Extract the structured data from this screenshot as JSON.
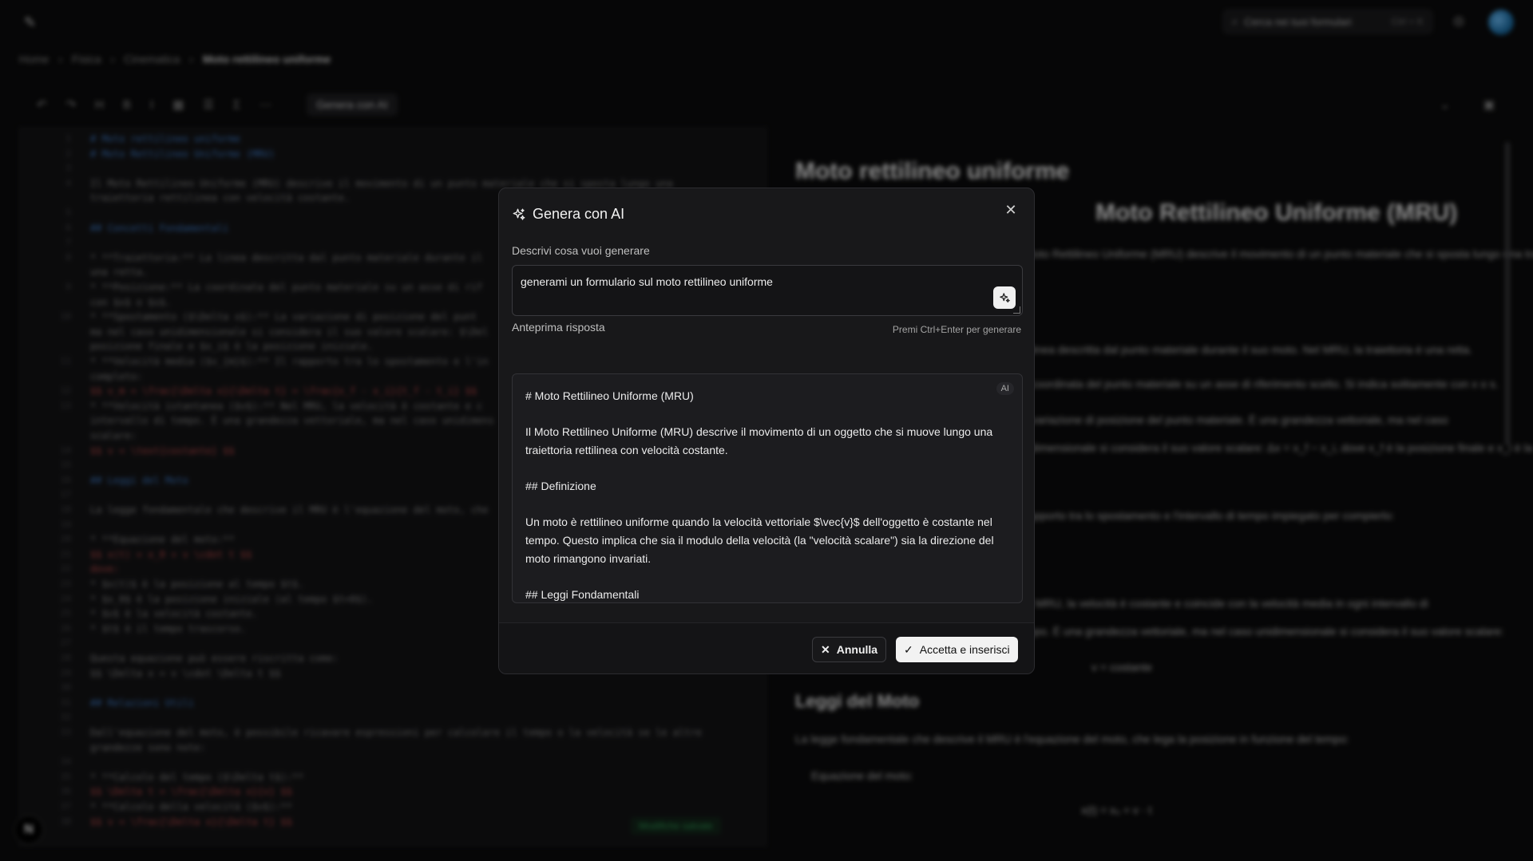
{
  "app": {
    "search_placeholder": "Cerca nei tuoi formulari",
    "search_shortcut": "Ctrl + K",
    "breadcrumb": [
      "Home",
      "Fisica",
      "Cinematica",
      "Moto rettilineo uniforme"
    ],
    "toolbar_ai_label": "Genera con AI",
    "saved_label": "Modifiche salvate",
    "editor_lines": [
      {
        "n": "1",
        "t": "# Moto rettilineo uniforme",
        "k": "h"
      },
      {
        "n": "2",
        "t": "# Moto Rettilineo Uniforme (MRU)",
        "k": "h"
      },
      {
        "n": "3",
        "t": "",
        "k": ""
      },
      {
        "n": "4",
        "t": "Il Moto Rettilineo Uniforme (MRU) descrive il movimento di un punto materiale che si sposta lungo una",
        "k": ""
      },
      {
        "n": "",
        "t": "traiettoria rettilinea con velocità costante.",
        "k": ""
      },
      {
        "n": "5",
        "t": "",
        "k": ""
      },
      {
        "n": "6",
        "t": "## Concetti Fondamentali",
        "k": "h"
      },
      {
        "n": "7",
        "t": "",
        "k": ""
      },
      {
        "n": "8",
        "t": "*   **Traiettoria:** La linea descritta dal punto materiale durante il",
        "k": ""
      },
      {
        "n": "",
        "t": "una retta.",
        "k": ""
      },
      {
        "n": "9",
        "t": "*   **Posizione:** La coordinata del punto materiale su un asse di rif",
        "k": ""
      },
      {
        "n": "",
        "t": "con $x$ o $s$.",
        "k": ""
      },
      {
        "n": "10",
        "t": "*   **Spostamento ($\\Delta x$):** La variazione di posizione del punt",
        "k": ""
      },
      {
        "n": "",
        "t": "ma nel caso unidimensionale si considera il suo valore scalare: $\\Del",
        "k": ""
      },
      {
        "n": "",
        "t": "posizione finale e $x_i$ è la posizione iniziale.",
        "k": ""
      },
      {
        "n": "11",
        "t": "*   **Velocità media ($v_{m}$):** Il rapporto tra lo spostamento e l'in",
        "k": ""
      },
      {
        "n": "",
        "t": "completo:",
        "k": ""
      },
      {
        "n": "12",
        "t": "    $$ v_m = \\frac{\\Delta x}{\\Delta t} = \\frac{x_f - x_i}{t_f - t_i} $$",
        "k": "r"
      },
      {
        "n": "13",
        "t": "*   **Velocità istantanea ($v$):** Nel MRU, la velocità è costante e c",
        "k": ""
      },
      {
        "n": "",
        "t": "intervallo di tempo. È una grandezza vettoriale, ma nel caso unidimens",
        "k": ""
      },
      {
        "n": "",
        "t": "scalare:",
        "k": ""
      },
      {
        "n": "14",
        "t": "    $$ v = \\text{costante} $$",
        "k": "r"
      },
      {
        "n": "15",
        "t": "",
        "k": ""
      },
      {
        "n": "16",
        "t": "## Leggi del Moto",
        "k": "h"
      },
      {
        "n": "17",
        "t": "",
        "k": ""
      },
      {
        "n": "18",
        "t": "La legge fondamentale che descrive il MRU è l'equazione del moto, che",
        "k": ""
      },
      {
        "n": "19",
        "t": "",
        "k": ""
      },
      {
        "n": "20",
        "t": "*   **Equazione del moto:**",
        "k": ""
      },
      {
        "n": "21",
        "t": "    $$ x(t) = x_0 + v \\cdot t $$",
        "k": "r"
      },
      {
        "n": "22",
        "t": "    dove:",
        "k": "r"
      },
      {
        "n": "23",
        "t": "    *   $x(t)$ è la posizione al tempo $t$.",
        "k": ""
      },
      {
        "n": "24",
        "t": "    *   $x_0$ è la posizione iniziale (al tempo $t=0$).",
        "k": ""
      },
      {
        "n": "25",
        "t": "    *   $v$ è la velocità costante.",
        "k": ""
      },
      {
        "n": "26",
        "t": "    *   $t$ è il tempo trascorso.",
        "k": ""
      },
      {
        "n": "27",
        "t": "",
        "k": ""
      },
      {
        "n": "28",
        "t": "Questa equazione può essere riscritta come:",
        "k": ""
      },
      {
        "n": "29",
        "t": "$$ \\Delta x = v \\cdot \\Delta t $$",
        "k": ""
      },
      {
        "n": "30",
        "t": "",
        "k": ""
      },
      {
        "n": "31",
        "t": "## Relazioni Utili",
        "k": "h"
      },
      {
        "n": "32",
        "t": "",
        "k": ""
      },
      {
        "n": "33",
        "t": "Dall'equazione del moto, è possibile ricavare espressioni per calcolare il tempo o la velocità se le altre",
        "k": ""
      },
      {
        "n": "",
        "t": "grandezze sono note:",
        "k": ""
      },
      {
        "n": "34",
        "t": "",
        "k": ""
      },
      {
        "n": "35",
        "t": "*   **Calcolo del tempo ($\\Delta t$):**",
        "k": ""
      },
      {
        "n": "36",
        "t": "    $$ \\Delta t = \\frac{\\Delta x}{v} $$",
        "k": "r"
      },
      {
        "n": "37",
        "t": "*   **Calcolo della velocità ($v$):**",
        "k": ""
      },
      {
        "n": "38",
        "t": "    $$ v = \\frac{\\Delta x}{\\Delta t} $$",
        "k": "r"
      }
    ],
    "preview": {
      "title": "Moto rettilineo uniforme",
      "subtitle": "Moto Rettilineo Uniforme (MRU)",
      "p1": "Il Moto Rettilineo Uniforme (MRU) descrive il movimento di un punto materiale che si sposta lungo una traiettoria",
      "p2": "La linea descritta dal punto materiale durante il suo moto. Nel MRU, la traiettoria è una retta.",
      "p3": "La coordinata del punto materiale su un asse di riferimento scelto. Si indica solitamente con x o s.",
      "p4": "La variazione di posizione del punto materiale. È una grandezza vettoriale, ma nel caso",
      "p5": "unidimensionale si considera il suo valore scalare: Δx = x_f − x_i, dove x_f è la posizione finale e x_i è la",
      "p6": "Il rapporto tra lo spostamento e l'intervallo di tempo impiegato per compierlo:",
      "p7": "Nel MRU, la velocità è costante e coincide con la velocità media in ogni intervallo di",
      "p8": "tempo. È una grandezza vettoriale, ma nel caso unidimensionale si considera il suo valore scalare:",
      "p9": "v = costante",
      "h2": "Leggi del Moto",
      "p10": "La legge fondamentale che descrive il MRU è l'equazione del moto, che lega la posizione in funzione del tempo:",
      "p11": "Equazione del moto:",
      "p12": "x(t) = x₀ + v · t"
    }
  },
  "modal": {
    "title": "Genera con AI",
    "prompt_label": "Descrivi cosa vuoi generare",
    "prompt_value": "generami un formulario sul moto rettilineo uniforme",
    "hint": "Premi Ctrl+Enter per generare",
    "preview_label": "Anteprima risposta",
    "ai_badge": "AI",
    "response": [
      "# Moto Rettilineo Uniforme (MRU)",
      "Il Moto Rettilineo Uniforme (MRU) descrive il movimento di un oggetto che si muove lungo una traiettoria rettilinea con velocità costante.",
      "## Definizione",
      "Un moto è rettilineo uniforme quando la velocità vettoriale $\\vec{v}$ dell'oggetto è costante nel tempo. Questo implica che sia il modulo della velocità (la \"velocità scalare\") sia la direzione del moto rimangono invariati.",
      "## Leggi Fondamentali"
    ],
    "cancel_label": "Annulla",
    "accept_label": "Accetta e inserisci"
  }
}
